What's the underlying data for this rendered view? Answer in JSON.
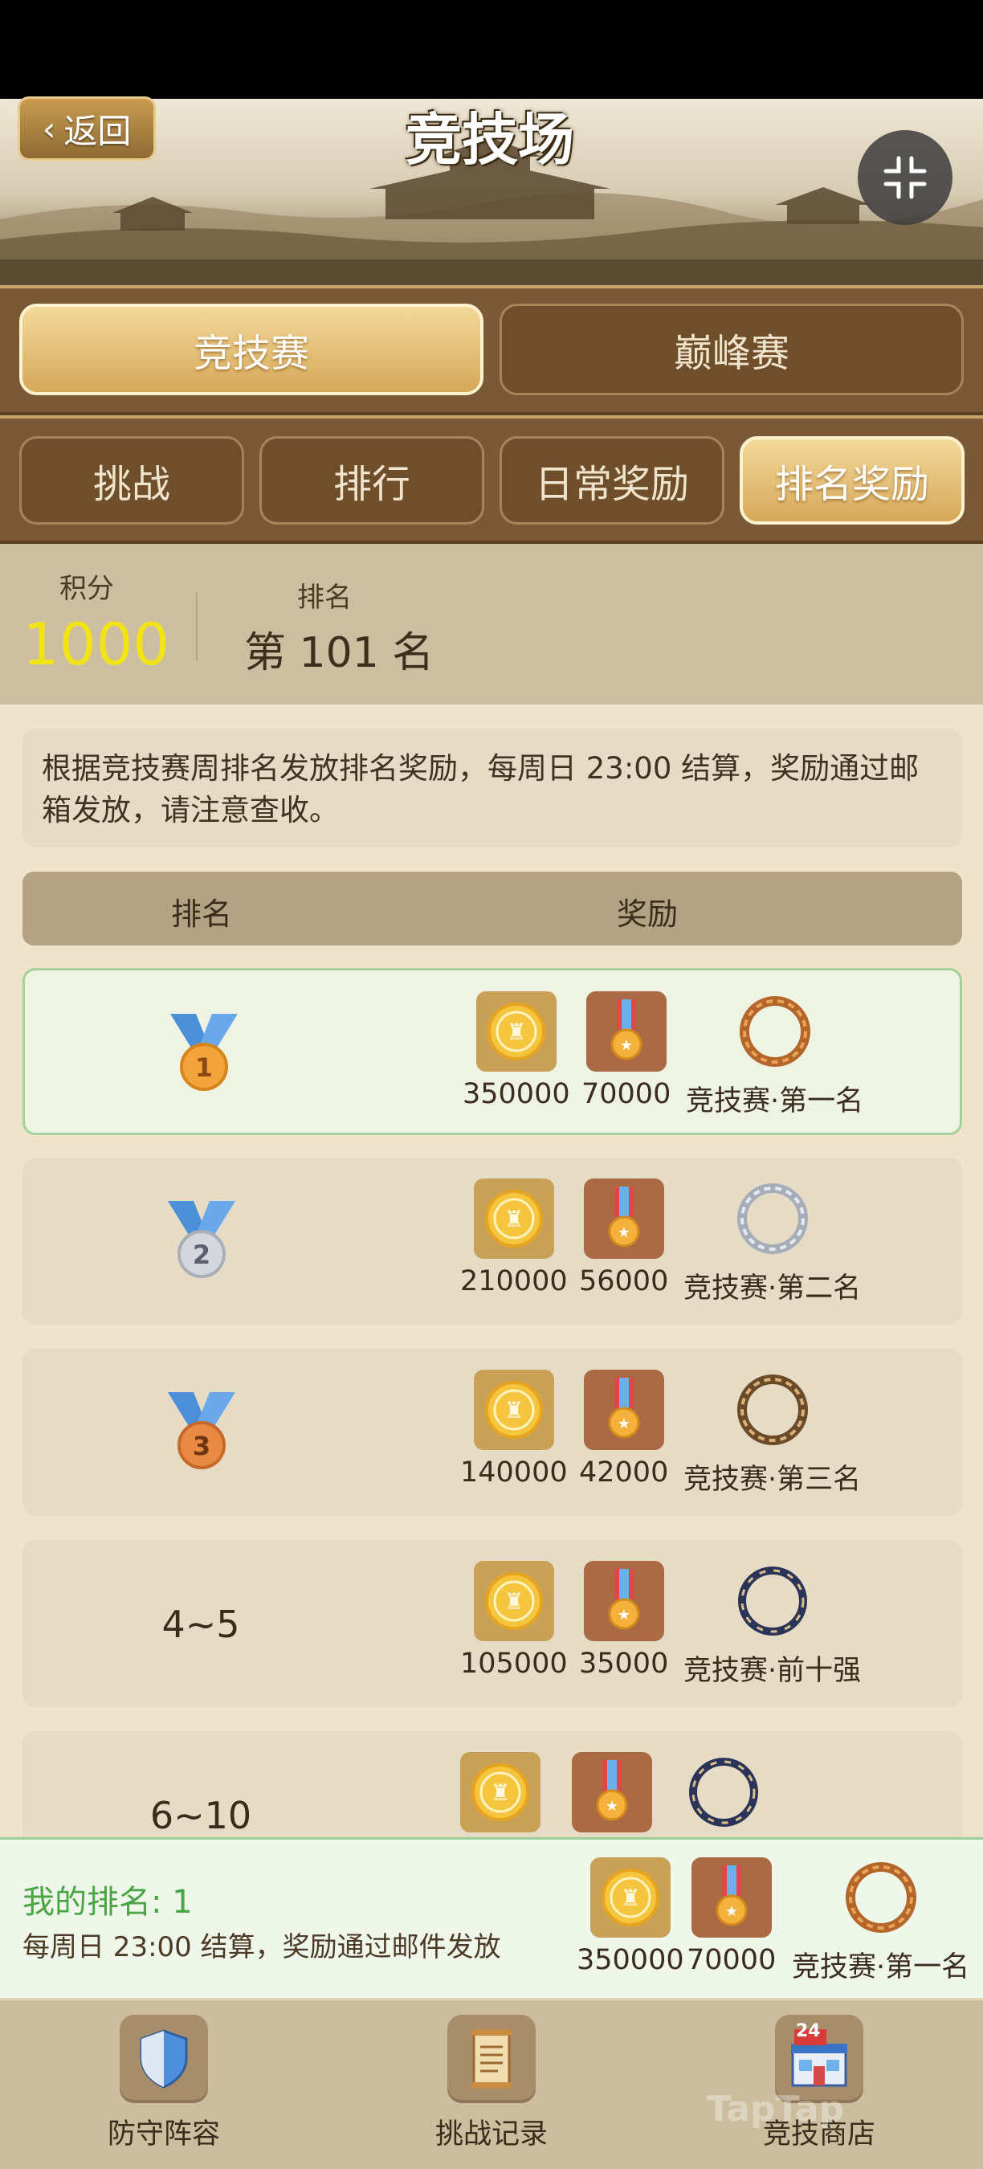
{
  "header": {
    "title": "竞技场",
    "back_label": "返回",
    "back_icon": "chevron-left-icon",
    "collapse_icon": "collapse-arrows-icon"
  },
  "mode_tabs": [
    {
      "label": "竞技赛",
      "active": true
    },
    {
      "label": "巅峰赛",
      "active": false
    }
  ],
  "sub_tabs": [
    {
      "label": "挑战",
      "active": false
    },
    {
      "label": "排行",
      "active": false
    },
    {
      "label": "日常奖励",
      "active": false
    },
    {
      "label": "排名奖励",
      "active": true
    }
  ],
  "score": {
    "score_label": "积分",
    "score_value": "1000",
    "rank_label": "排名",
    "rank_value": "第 101 名"
  },
  "notice": "根据竞技赛周排名发放排名奖励，每周日 23:00 结算，奖励通过邮箱发放，请注意查收。",
  "table": {
    "col_rank": "排名",
    "col_reward": "奖励",
    "rows": [
      {
        "rank": "1",
        "coins": "350000",
        "medals": "70000",
        "frame": "竞技赛·第一名"
      },
      {
        "rank": "2",
        "coins": "210000",
        "medals": "56000",
        "frame": "竞技赛·第二名"
      },
      {
        "rank": "3",
        "coins": "140000",
        "medals": "42000",
        "frame": "竞技赛·第三名"
      },
      {
        "rank": "4~5",
        "coins": "105000",
        "medals": "35000",
        "frame": "竞技赛·前十强"
      },
      {
        "rank": "6~10"
      }
    ]
  },
  "my_rank": {
    "title": "我的排名: 1",
    "desc": "每周日 23:00 结算，奖励通过邮件发放",
    "coins": "350000",
    "medals": "70000",
    "frame": "竞技赛·第一名"
  },
  "bottom_nav": [
    {
      "label": "防守阵容",
      "icon": "shield-icon"
    },
    {
      "label": "挑战记录",
      "icon": "scroll-icon"
    },
    {
      "label": "竞技商店",
      "icon": "shop-icon",
      "badge": "24"
    }
  ],
  "watermark": "TapTap",
  "colors": {
    "accent_gold": "#d6a85a",
    "score_yellow": "#f2e316",
    "my_rank_green": "#4aa544"
  }
}
